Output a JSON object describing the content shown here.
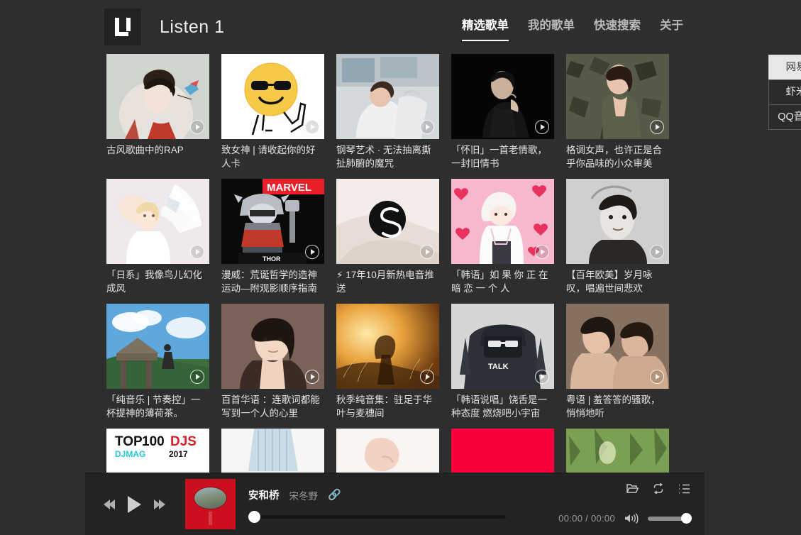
{
  "header": {
    "logo_alt": "listen1-logo",
    "title": "Listen 1",
    "nav": [
      {
        "label": "精选歌单",
        "active": true
      },
      {
        "label": "我的歌单",
        "active": false
      },
      {
        "label": "快速搜索",
        "active": false
      },
      {
        "label": "关于",
        "active": false
      }
    ]
  },
  "sources": [
    {
      "label": "网易",
      "active": true
    },
    {
      "label": "虾米",
      "active": false
    },
    {
      "label": "QQ音乐",
      "active": false
    }
  ],
  "playlists": [
    {
      "title": "古风歌曲中的RAP",
      "art": "guofeng-illustration"
    },
    {
      "title": "致女神 | 请收起你的好人卡",
      "art": "sunglasses-emoji"
    },
    {
      "title": "钢琴艺术 · 无法抽离撕扯肺腑的魔咒",
      "art": "woman-at-window"
    },
    {
      "title": "「怀旧」一首老情歌，一封旧情书",
      "art": "man-bw-portrait"
    },
    {
      "title": "格调女声，也许正是合乎你品味的小众审美",
      "art": "camo-jacket-woman"
    },
    {
      "title": "「日系」我像鸟儿幻化成风",
      "art": "anime-angel-girl"
    },
    {
      "title": "漫威：荒诞哲学的造神运动—附观影顺序指南",
      "art": "marvel-thor-figure"
    },
    {
      "title": "⚡ 17年10月新热电音推送",
      "art": "spinnin-records-logo"
    },
    {
      "title": "「韩语」如 果 你 正 在 暗 恋 一 个 人",
      "art": "pink-hearts-girl"
    },
    {
      "title": "【百年欧美】岁月咏叹，唱遍世间悲欢",
      "art": "audrey-hepburn-bw"
    },
    {
      "title": "「纯音乐 | 节奏控」一杯提神的薄荷茶。",
      "art": "anime-sky-stairs"
    },
    {
      "title": "百首华语 ：连歌词都能写到一个人的心里",
      "art": "portrait-woman-soft"
    },
    {
      "title": "秋季纯音集：驻足于华叶与麦穗间",
      "art": "golden-field-sunset"
    },
    {
      "title": "「韩语说唱」饶舌是一种态度 燃烧吧小宇宙",
      "art": "hoodie-face-cover"
    },
    {
      "title": "粤语 | 羞答答的骚歌，悄悄地听",
      "art": "two-women-bw"
    },
    {
      "title": "",
      "art": "top100-djs-2017"
    },
    {
      "title": "",
      "art": "blue-dress-fabric"
    },
    {
      "title": "",
      "art": "anime-hand-pale"
    },
    {
      "title": "",
      "art": "solid-red-cover"
    },
    {
      "title": "",
      "art": "green-forest-light"
    }
  ],
  "player": {
    "prev_label": "上一首",
    "play_label": "播放",
    "next_label": "下一首",
    "album_alt": "安和桥北-album-cover",
    "song": "安和桥",
    "artist": "宋冬野",
    "link_icon": "🔗",
    "time_display": "00:00 / 00:00",
    "progress_percent": 0,
    "volume_percent": 100,
    "utils": [
      {
        "name": "folder-icon",
        "label": "打开文件夹"
      },
      {
        "name": "repeat-icon",
        "label": "循环模式"
      },
      {
        "name": "playlist-icon",
        "label": "播放列表"
      }
    ]
  },
  "colors": {
    "page_bg": "#2e2e2e",
    "player_bg": "#232323",
    "accent_text": "#ffffff",
    "album_red": "#cc0f1f"
  }
}
